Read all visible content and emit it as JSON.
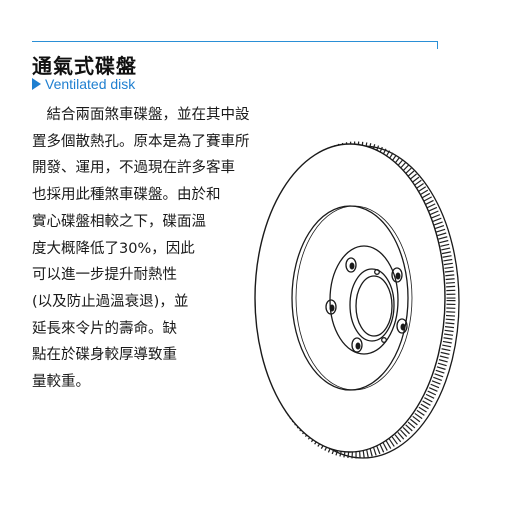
{
  "heading": {
    "title": "通氣式碟盤",
    "subtitle": "Ventilated disk",
    "accent_color": "#1f7fd0"
  },
  "paragraph": {
    "lines": [
      "　結合兩面煞車碟盤，並在其中設",
      "置多個散熱孔。原本是為了賽車所",
      "開發、運用，不過現在許多客車",
      "也採用此種煞車碟盤。由於和",
      "實心碟盤相較之下，碟面溫",
      "度大概降低了30%，因此",
      "可以進一步提升耐熱性",
      "(以及防止過溫衰退)，並",
      "延長來令片的壽命。缺",
      "點在於碟身較厚導致重",
      "量較重。"
    ]
  },
  "illustration": {
    "icon": "ventilated-brake-disc-icon"
  }
}
